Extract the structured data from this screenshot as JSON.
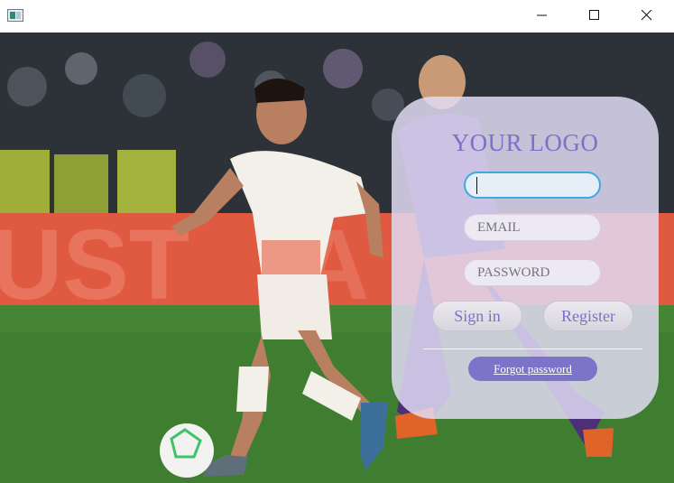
{
  "window": {
    "title": "",
    "controls": [
      "minimize",
      "maximize",
      "close"
    ]
  },
  "background": {
    "icon": "football-match-photo"
  },
  "login": {
    "logo": "YOUR LOGO",
    "username_value": "",
    "email_placeholder": "EMAIL",
    "password_placeholder": "PASSWORD",
    "signin_label": "Sign in",
    "register_label": "Register",
    "forgot_label": "Forgot password"
  },
  "colors": {
    "accent": "#7a72c8",
    "focus_ring": "#3ea8e0",
    "card_bg": "#e2dcf6"
  }
}
